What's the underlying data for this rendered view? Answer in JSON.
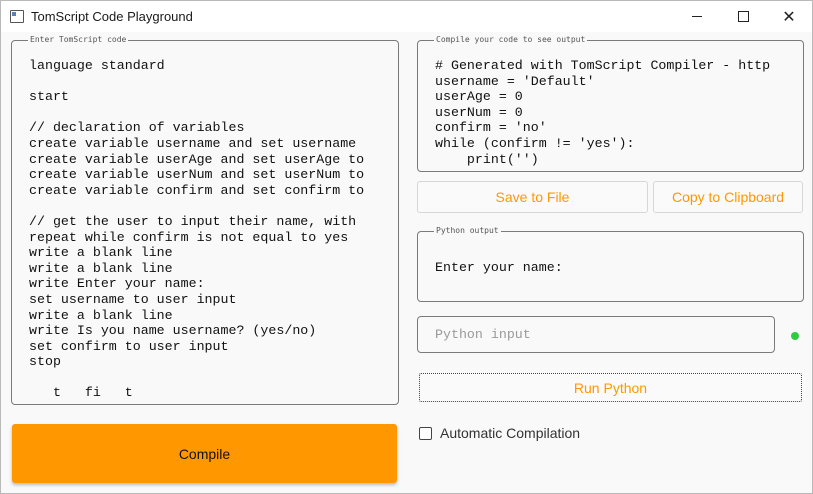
{
  "window": {
    "title": "TomScript Code Playground",
    "controls": {
      "minimize": "minimize-icon",
      "maximize": "maximize-icon",
      "close": "close-icon"
    }
  },
  "editor": {
    "label": "Enter TomScript code",
    "code": "language standard\n\nstart\n\n// declaration of variables\ncreate variable username and set username\ncreate variable userAge and set userAge to\ncreate variable userNum and set userNum to\ncreate variable confirm and set confirm to\n\n// get the user to input their name, with\nrepeat while confirm is not equal to yes\nwrite a blank line\nwrite a blank line\nwrite Enter your name:\nset username to user input\nwrite a blank line\nwrite Is you name username? (yes/no)\nset confirm to user input\nstop\n\n   t   fi   t"
  },
  "output": {
    "label": "Compile your code to see output",
    "code": "# Generated with TomScript Compiler - http\nusername = 'Default'\nuserAge = 0\nuserNum = 0\nconfirm = 'no'\nwhile (confirm != 'yes'):\n    print('')"
  },
  "actions": {
    "save": "Save to File",
    "copy": "Copy to Clipboard",
    "compile": "Compile",
    "run": "Run Python"
  },
  "python_output": {
    "label": "Python output",
    "text": "Enter your name:"
  },
  "python_input": {
    "placeholder": "Python input",
    "value": ""
  },
  "status": {
    "color": "#2ecc40"
  },
  "auto_compile": {
    "label": "Automatic Compilation",
    "checked": false
  },
  "colors": {
    "accent": "#ff9800"
  }
}
